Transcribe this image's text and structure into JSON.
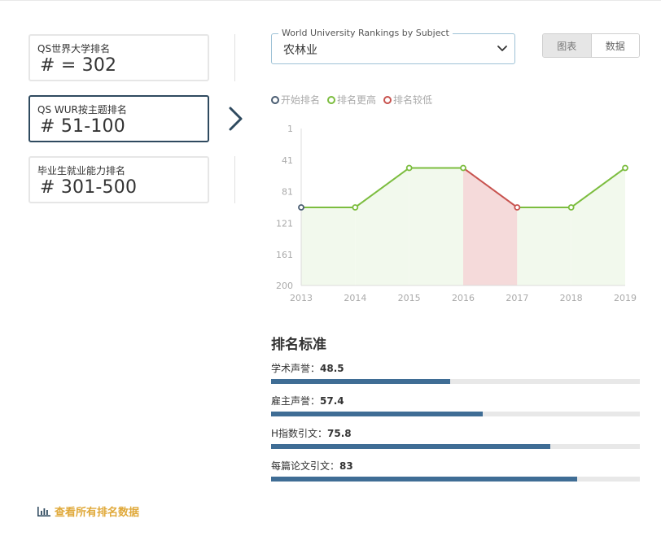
{
  "rankings": [
    {
      "label": "QS世界大学排名",
      "value": "# = 302",
      "active": false
    },
    {
      "label": "QS WUR按主题排名",
      "value": "# 51-100",
      "active": true
    },
    {
      "label": "毕业生就业能力排名",
      "value": "# 301-500",
      "active": false
    }
  ],
  "all_link": {
    "label": "查看所有排名数据",
    "icon": "bar-chart-icon"
  },
  "subject_select": {
    "legend": "World University Rankings by Subject",
    "value": "农林业"
  },
  "view_toggle": {
    "chart_label": "图表",
    "data_label": "数据",
    "selected": "chart"
  },
  "legend": [
    {
      "label": "开始排名",
      "color": "#4a5d72"
    },
    {
      "label": "排名更高",
      "color": "#7cbd3f"
    },
    {
      "label": "排名较低",
      "color": "#c8534f"
    }
  ],
  "chart_data": {
    "type": "line",
    "x": [
      "2013",
      "2014",
      "2015",
      "2016",
      "2017",
      "2018",
      "2019"
    ],
    "values": [
      101,
      101,
      51,
      51,
      101,
      101,
      51
    ],
    "y_ticks": [
      "1",
      "41",
      "81",
      "121",
      "161",
      "200"
    ],
    "ylim": [
      1,
      200
    ],
    "y_inverted": true,
    "colors": {
      "start": "#4a5d72",
      "higher": "#7cbd3f",
      "lower": "#c8534f",
      "higher_fill": "#f2f9ed",
      "lower_fill": "#f5dada"
    },
    "grid": false
  },
  "criteria": {
    "title": "排名标准",
    "items": [
      {
        "label": "学术声誉：",
        "value": "48.5",
        "score": 48.5
      },
      {
        "label": "雇主声誉：",
        "value": "57.4",
        "score": 57.4
      },
      {
        "label": "H指数引文：",
        "value": "75.8",
        "score": 75.8
      },
      {
        "label": "每篇论文引文：",
        "value": "83",
        "score": 83
      }
    ],
    "bar_color": "#3f6d95"
  }
}
